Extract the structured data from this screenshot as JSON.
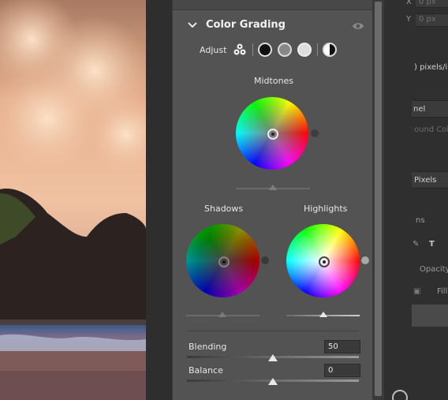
{
  "color_grading": {
    "title": "Color Grading",
    "adjust_label": "Adjust",
    "midtones_label": "Midtones",
    "shadows_label": "Shadows",
    "highlights_label": "Highlights",
    "blending_label": "Blending",
    "blending_value": "50",
    "balance_label": "Balance",
    "balance_value": "0"
  },
  "right_panel": {
    "x_label": "X",
    "y_label": "Y",
    "x_value": "0 px",
    "y_value": "0 px",
    "resolution": ") pixels/in",
    "channel": "nel",
    "background_color": "ound Color",
    "pixels": "Pixels",
    "layers_tab": "ns",
    "opacity": "Opacity",
    "fill": "Fill"
  },
  "icons": {
    "collapse": "chevron-down-icon",
    "visibility": "eye-icon",
    "three_way": "three-way-wheels-icon",
    "shadows": "shadows-mode-icon",
    "midtones": "midtones-mode-icon",
    "highlights": "highlights-mode-icon",
    "global": "global-mode-icon"
  }
}
